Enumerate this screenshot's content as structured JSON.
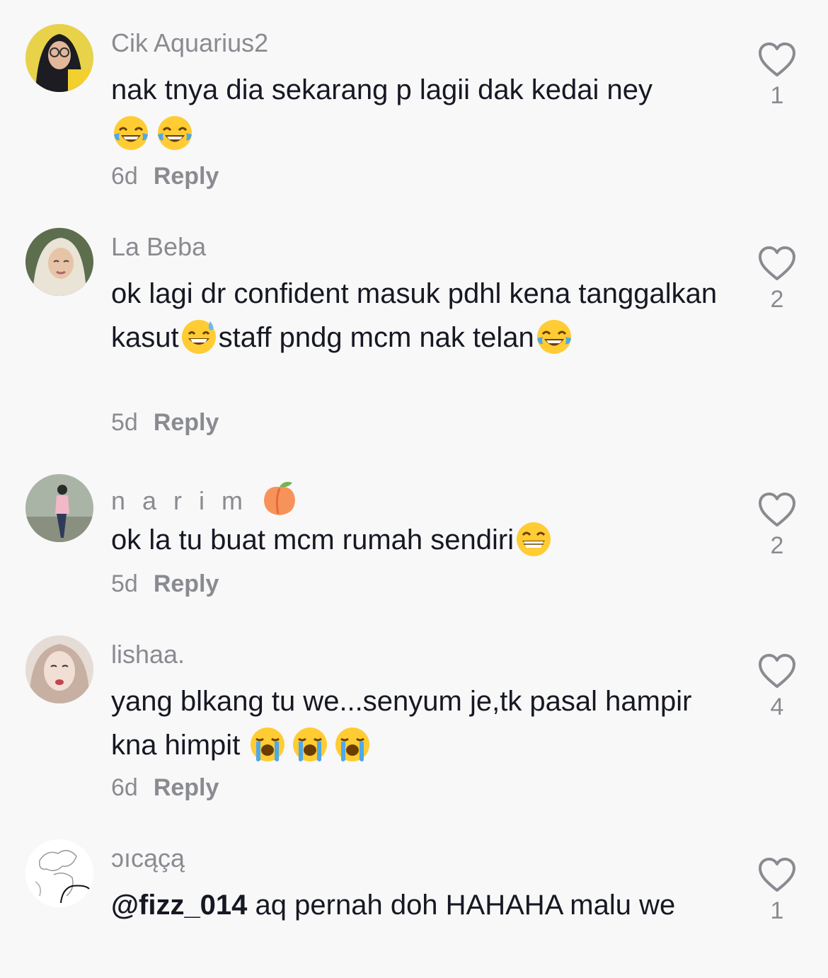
{
  "comments": [
    {
      "username": "Cik Aquarius2",
      "text": "nak tnya dia sekarang p lagii dak kedai ney",
      "emojis": [
        "face-with-tears-of-joy",
        "face-with-tears-of-joy"
      ],
      "time": "6d",
      "reply_label": "Reply",
      "likes": "1"
    },
    {
      "username": "La Beba",
      "text_part1": "ok lagi dr confident masuk pdhl kena tanggalkan kasut",
      "text_part2": "staff pndg mcm nak telan",
      "emojis": [
        "grinning-face-with-sweat",
        "face-with-tears-of-joy"
      ],
      "time": "5d",
      "reply_label": "Reply",
      "likes": "2"
    },
    {
      "username": "n a r i m",
      "username_emoji": "peach",
      "text": "ok la tu buat mcm rumah sendiri",
      "emojis": [
        "beaming-face-with-smiling-eyes"
      ],
      "time": "5d",
      "reply_label": "Reply",
      "likes": "2"
    },
    {
      "username": "lishaa.",
      "text": "yang blkang tu we...senyum je,tk pasal hampir kna himpit",
      "emojis": [
        "loudly-crying-face",
        "loudly-crying-face",
        "loudly-crying-face"
      ],
      "time": "6d",
      "reply_label": "Reply",
      "likes": "4"
    },
    {
      "username": "ɔıcąçą",
      "mention": "@fizz_014",
      "text": "aq pernah doh HAHAHA malu we",
      "likes": "1"
    }
  ],
  "icons": {
    "like": "heart-outline-icon"
  },
  "colors": {
    "background": "#f8f8f8",
    "text": "#161823",
    "muted": "#8a8b91"
  }
}
